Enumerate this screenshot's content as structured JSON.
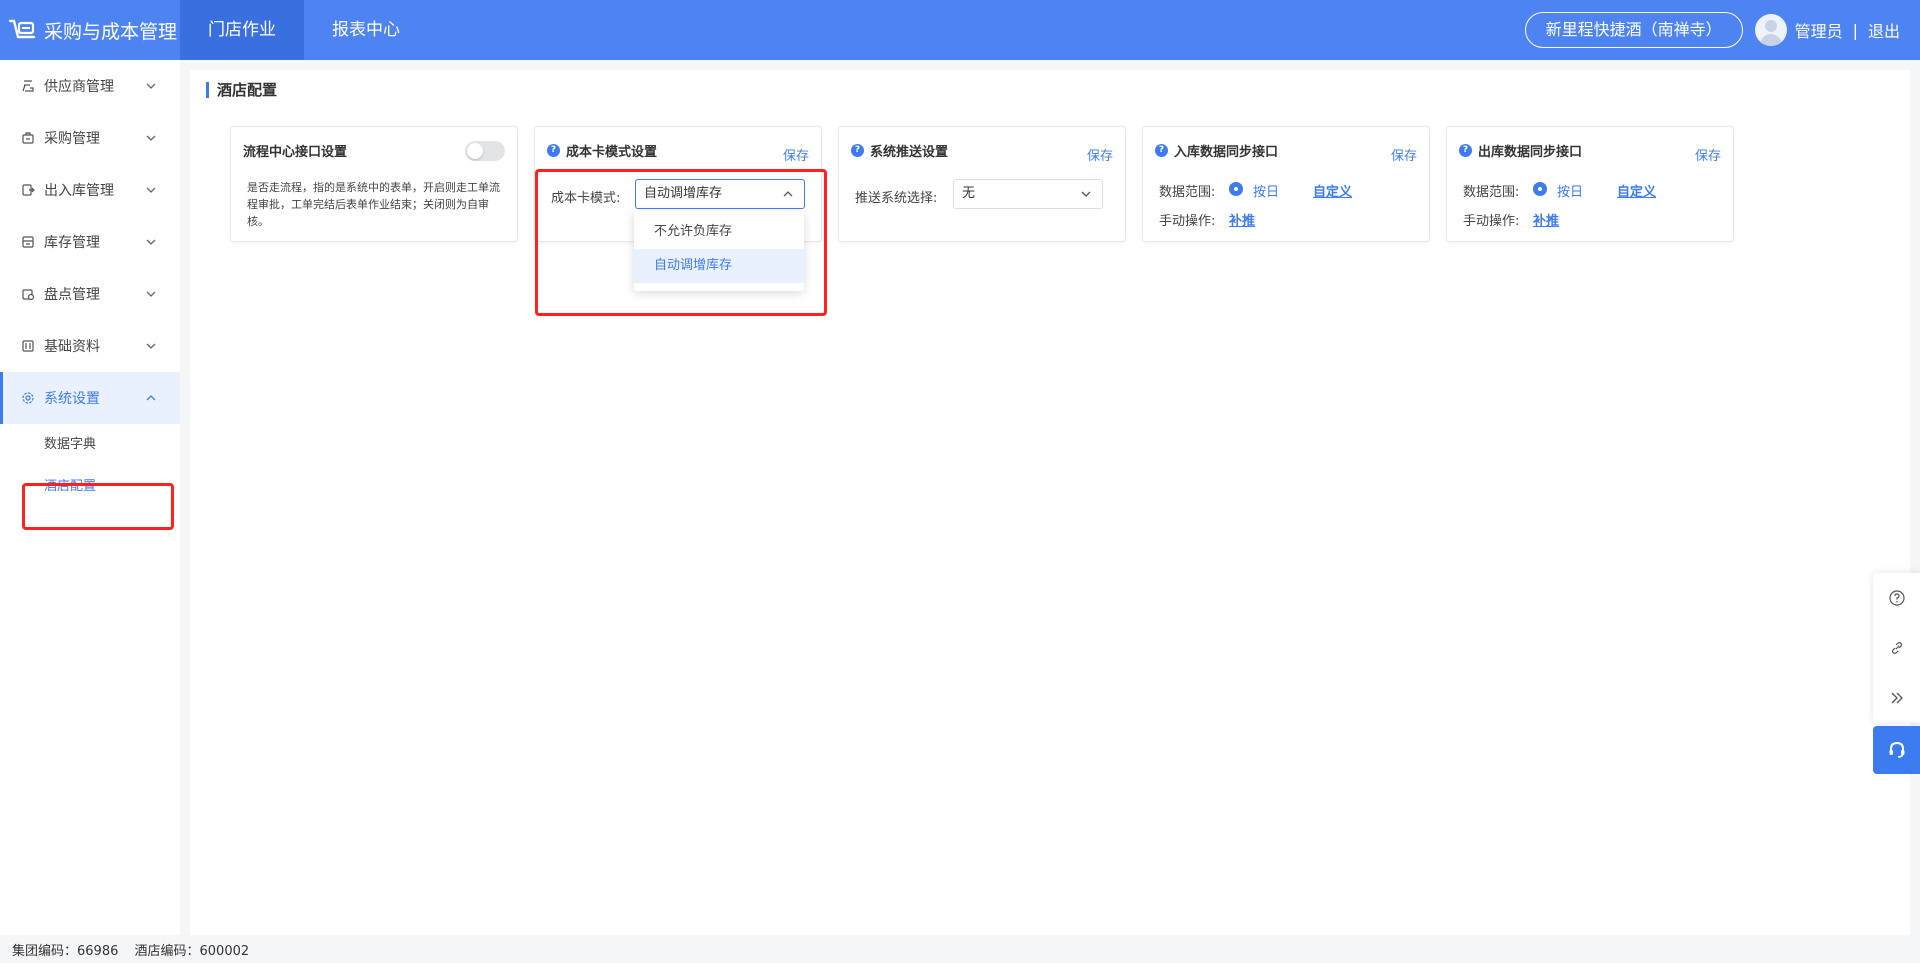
{
  "header": {
    "app_title": "采购与成本管理",
    "nav": [
      {
        "label": "门店作业",
        "active": true
      },
      {
        "label": "报表中心",
        "active": false
      }
    ],
    "hotel_name": "新里程快捷酒（南禅寺）",
    "user_name": "管理员",
    "separator": "|",
    "logout": "退出"
  },
  "sidebar": {
    "items": [
      {
        "label": "供应商管理",
        "icon": "supplier-icon"
      },
      {
        "label": "采购管理",
        "icon": "purchase-icon"
      },
      {
        "label": "出入库管理",
        "icon": "inout-icon"
      },
      {
        "label": "库存管理",
        "icon": "inventory-icon"
      },
      {
        "label": "盘点管理",
        "icon": "stocktake-icon"
      },
      {
        "label": "基础资料",
        "icon": "basic-data-icon"
      },
      {
        "label": "系统设置",
        "icon": "gear-icon",
        "expanded": true
      }
    ],
    "sub_items": [
      {
        "label": "数据字典"
      },
      {
        "label": "酒店配置",
        "active": true
      }
    ]
  },
  "page": {
    "title": "酒店配置"
  },
  "cards": {
    "flow": {
      "title": "流程中心接口设置",
      "enabled": false,
      "description": "是否走流程，指的是系统中的表单，开启则走工单流程审批，工单完结后表单作业结束；关闭则为自审核。"
    },
    "cost": {
      "title": "成本卡模式设置",
      "save": "保存",
      "field_label": "成本卡模式:",
      "selected": "自动调增库存",
      "options": [
        "不允许负库存",
        "自动调增库存"
      ]
    },
    "push": {
      "title": "系统推送设置",
      "save": "保存",
      "field_label": "推送系统选择:",
      "selected": "无"
    },
    "inbound": {
      "title": "入库数据同步接口",
      "save": "保存",
      "range_label": "数据范围:",
      "range_option": "按日",
      "custom_link": "自定义",
      "manual_label": "手动操作:",
      "manual_link": "补推"
    },
    "outbound": {
      "title": "出库数据同步接口",
      "save": "保存",
      "range_label": "数据范围:",
      "range_option": "按日",
      "custom_link": "自定义",
      "manual_label": "手动操作:",
      "manual_link": "补推"
    }
  },
  "float_tools": [
    "help-icon",
    "link-icon",
    "collapse-icon",
    "customer-service-icon"
  ],
  "footer": {
    "group_code": "集团编码：66986",
    "hotel_code": "酒店编码：600002"
  },
  "colors": {
    "primary": "#4d84f2",
    "accent": "#3d7bf0",
    "highlight": "#ff2020"
  }
}
